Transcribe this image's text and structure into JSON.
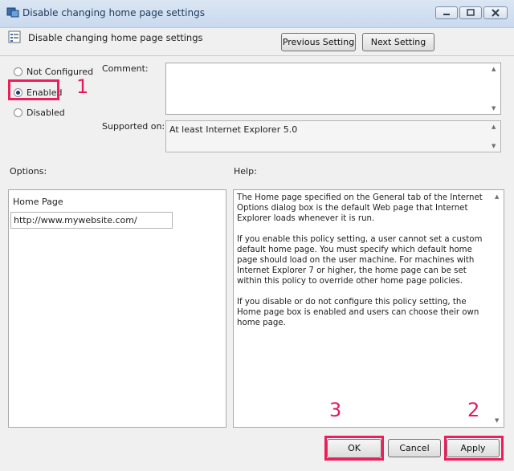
{
  "window": {
    "title": "Disable changing home page settings"
  },
  "header": {
    "policy_title": "Disable changing home page settings",
    "previous_label": "Previous Setting",
    "next_label": "Next Setting"
  },
  "state": {
    "options": [
      {
        "label": "Not Configured",
        "selected": false
      },
      {
        "label": "Enabled",
        "selected": true
      },
      {
        "label": "Disabled",
        "selected": false
      }
    ]
  },
  "comment": {
    "label": "Comment:",
    "value": ""
  },
  "supported": {
    "label": "Supported on:",
    "value": "At least Internet Explorer 5.0"
  },
  "options_section": {
    "label": "Options:",
    "homepage_label": "Home Page",
    "homepage_value": "http://www.mywebsite.com/"
  },
  "help_section": {
    "label": "Help:",
    "paragraphs": [
      "The Home page specified on the General tab of the Internet Options dialog box is the default Web page that Internet Explorer loads whenever it is run.",
      "If you enable this policy setting, a user cannot set a custom default home page. You must specify which default home page should load on the user machine. For machines with Internet Explorer 7 or higher, the home page can be set within this policy to override other home page policies.",
      "If you disable or do not configure this policy setting, the Home page box is enabled and users can choose their own home page."
    ]
  },
  "footer": {
    "ok_label": "OK",
    "cancel_label": "Cancel",
    "apply_label": "Apply"
  },
  "annotations": {
    "step1": "1",
    "step2": "2",
    "step3": "3",
    "highlight_color": "#ea1f5b"
  },
  "icons": [
    "group-policy-icon",
    "policy-setting-icon",
    "minimize-icon",
    "maximize-icon",
    "close-icon",
    "scroll-up-icon",
    "scroll-down-icon"
  ]
}
